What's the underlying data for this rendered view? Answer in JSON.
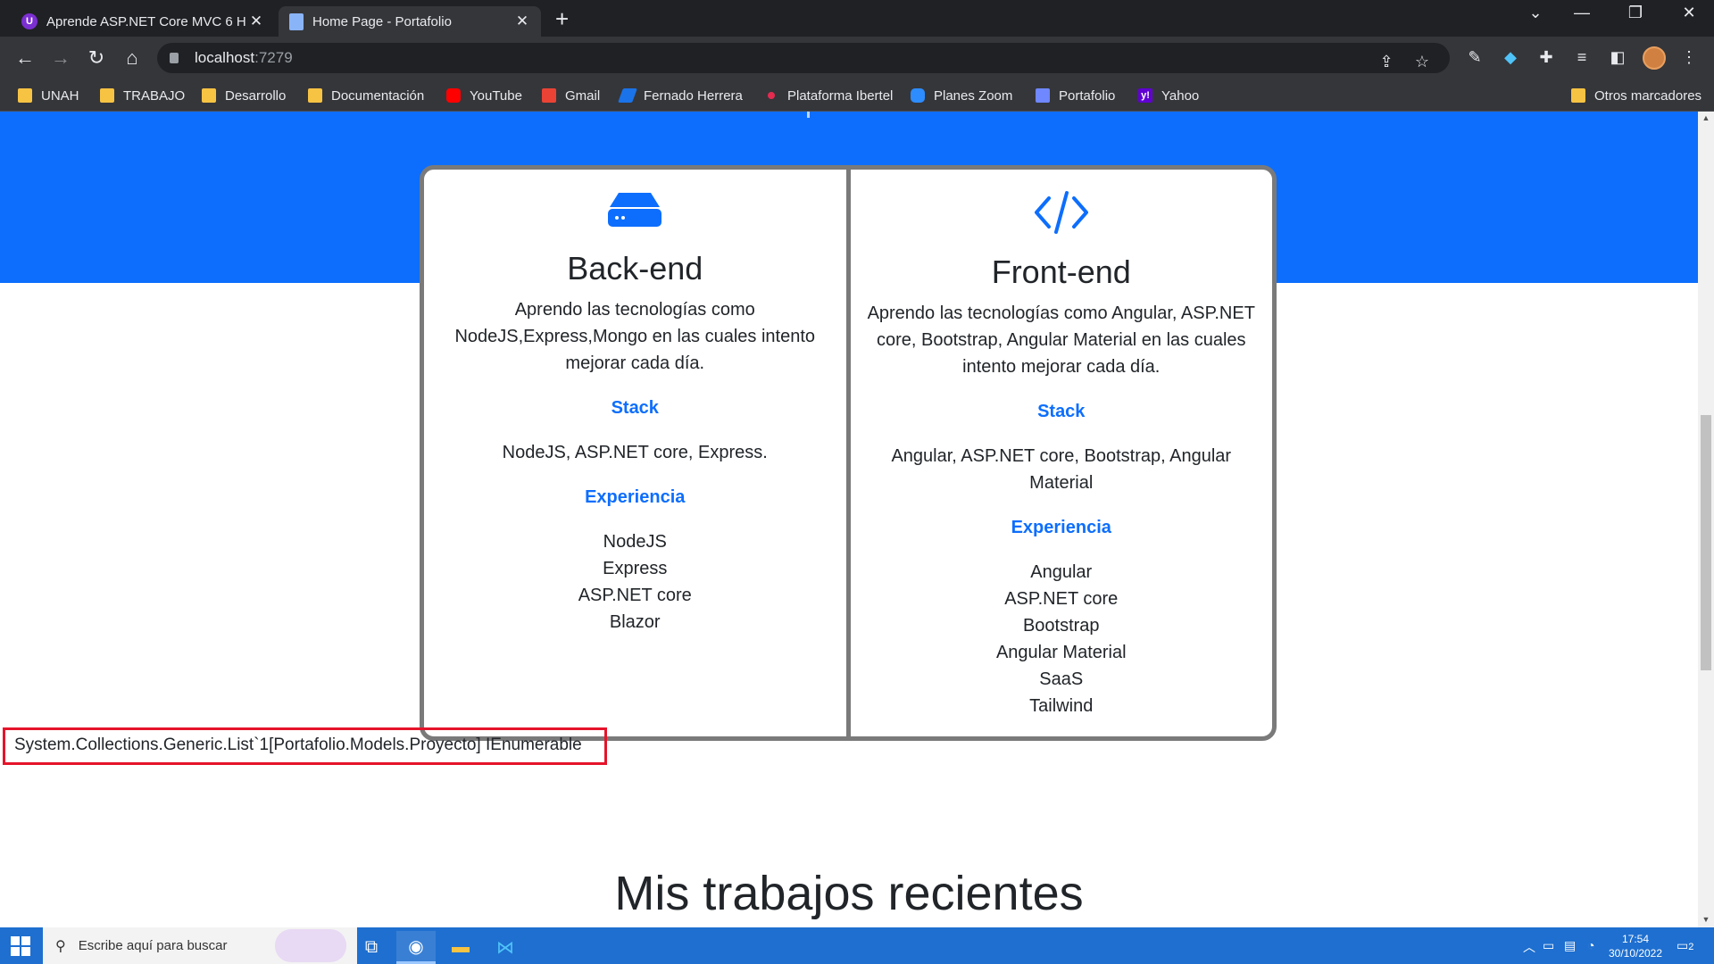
{
  "browser": {
    "tabs": [
      {
        "title": "Aprende ASP.NET Core MVC 6 H",
        "favicon": "udemy-logo",
        "active": false
      },
      {
        "title": "Home Page - Portafolio",
        "favicon": "document-icon",
        "active": true
      }
    ],
    "address": {
      "host": "localhost",
      "port": ":7279"
    },
    "bookmarks": [
      {
        "label": "UNAH",
        "icon": "folder"
      },
      {
        "label": "TRABAJO",
        "icon": "folder"
      },
      {
        "label": "Desarrollo",
        "icon": "folder"
      },
      {
        "label": "Documentación",
        "icon": "folder"
      },
      {
        "label": "YouTube",
        "icon": "youtube"
      },
      {
        "label": "Gmail",
        "icon": "gmail"
      },
      {
        "label": "Fernado Herrera",
        "icon": "site"
      },
      {
        "label": "Plataforma Ibertel",
        "icon": "site"
      },
      {
        "label": "Planes Zoom",
        "icon": "zoom"
      },
      {
        "label": "Portafolio",
        "icon": "site"
      },
      {
        "label": "Yahoo",
        "icon": "yahoo"
      }
    ],
    "other_bookmarks": "Otros marcadores"
  },
  "page": {
    "cards": [
      {
        "icon": "server-icon",
        "title": "Back-end",
        "description": "Aprendo las tecnologías como NodeJS,Express,Mongo en las cuales intento mejorar cada día.",
        "stack_heading": "Stack",
        "stack": "NodeJS, ASP.NET core, Express.",
        "experience_heading": "Experiencia",
        "experience": [
          "NodeJS",
          "Express",
          "ASP.NET core",
          "Blazor"
        ]
      },
      {
        "icon": "code-icon",
        "title": "Front-end",
        "description": "Aprendo las tecnologías como Angular, ASP.NET core, Bootstrap, Angular Material en las cuales intento mejorar cada día.",
        "stack_heading": "Stack",
        "stack": "Angular, ASP.NET core, Bootstrap, Angular Material",
        "experience_heading": "Experiencia",
        "experience": [
          "Angular",
          "ASP.NET core",
          "Bootstrap",
          "Angular Material",
          "SaaS",
          "Tailwind"
        ]
      }
    ],
    "debug_output": "System.Collections.Generic.List`1[Portafolio.Models.Proyecto] IEnumerable",
    "section_title": "Mis trabajos recientes"
  },
  "taskbar": {
    "search_placeholder": "Escribe aquí para buscar",
    "time": "17:54",
    "date": "30/10/2022",
    "notification_count": "2"
  },
  "colors": {
    "primary": "#0d6efd",
    "chrome_dark": "#202124",
    "chrome_toolbar": "#35363a",
    "highlight_border": "#e5142b",
    "taskbar": "#1e6fd0"
  }
}
